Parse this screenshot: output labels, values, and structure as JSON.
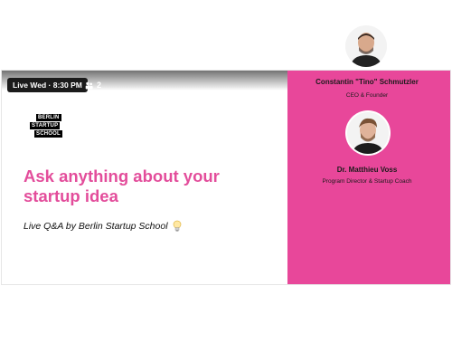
{
  "live": {
    "label": "Live Wed · 8:30 PM"
  },
  "viewers": {
    "count": "2",
    "icon": "people-icon"
  },
  "logo": {
    "lines": [
      "BERLIN",
      "STARTUP",
      "SCHOOL"
    ]
  },
  "headline": "Ask anything about your startup idea",
  "subtitle": "Live Q&A by Berlin Startup School",
  "speakers": [
    {
      "name": "Constantin \"Tino\" Schmutzler",
      "role": "CEO & Founder"
    },
    {
      "name": "Dr. Matthieu Voss",
      "role": "Program Director & Startup Coach"
    }
  ],
  "colors": {
    "accent": "#e8479a",
    "headline": "#e34d9b",
    "badge": "#1b1b1b"
  }
}
